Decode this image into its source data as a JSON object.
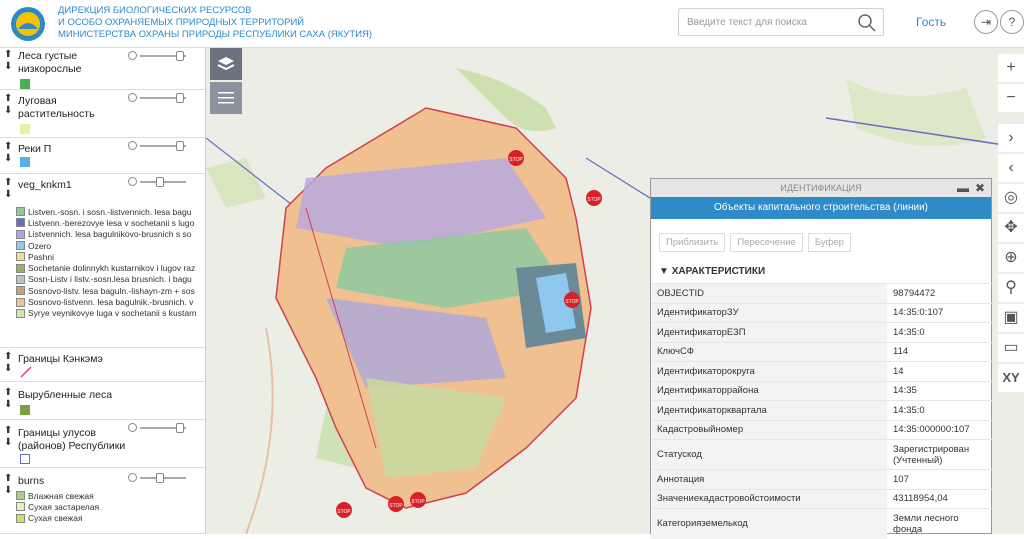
{
  "header": {
    "org_line1": "Дирекция биологических ресурсов",
    "org_line2": "и особо охраняемых природных территорий",
    "org_line3": "Министерства охраны природы Республики Саха (Якутия)",
    "search_placeholder": "Введите текст для поиска",
    "user": "Гость"
  },
  "layers": [
    {
      "name": "Леса густые низкорослые",
      "color": "#4caf50"
    },
    {
      "name": "Луговая растительность",
      "color": "#e4f2a0"
    },
    {
      "name": "Реки П",
      "color": "#5aaee8"
    },
    {
      "name": "veg_knkm1",
      "legend": [
        {
          "label": "Listven.-sosn. i sosn.-listvennich. lesa bagu",
          "color": "#8ec9a0"
        },
        {
          "label": "Listvenn.-berezovye lesa v sochetanii s lugo",
          "color": "#6a6ac8"
        },
        {
          "label": "Listvennich. lesa bagulnikovo-brusnich s so",
          "color": "#a8a8e0"
        },
        {
          "label": "Ozero",
          "color": "#8ec8f0"
        },
        {
          "label": "Pashni",
          "color": "#f5e08a"
        },
        {
          "label": "Sochetanie dolinnykh kustarnikov i lugov raz",
          "color": "#a0b060"
        },
        {
          "label": "Sosn-Listv i listv.-sosn.lesa brusnich. i bagu",
          "color": "#b8c8b8"
        },
        {
          "label": "Sosnovo-listv. lesa baguln.-lishayn-zm + sos",
          "color": "#c0a878"
        },
        {
          "label": "Sosnovo-listvenn. lesa bagulnik.-brusnich. v",
          "color": "#f0c090"
        },
        {
          "label": "Syrye veynikovye luga v sochetanii s kustarn",
          "color": "#d8e8a0"
        }
      ]
    },
    {
      "name": "Границы Кэнкэмэ",
      "color": "#e04060"
    },
    {
      "name": "Вырубленные леса",
      "color": "#7aa040"
    },
    {
      "name": "Границы улусов (районов) Республики",
      "color": "#ffffff"
    },
    {
      "name": "burns",
      "legend": [
        {
          "label": "Влажная свежая",
          "color": "#a8d080"
        },
        {
          "label": "Сухая застарелая",
          "color": "#e8f0c0"
        },
        {
          "label": "Сухая свежая",
          "color": "#c8e068"
        }
      ]
    }
  ],
  "panel": {
    "title": "Идентификация",
    "subtitle": "Объекты капитального строительства (линии)",
    "buttons": [
      "Приблизить",
      "Пересечение",
      "Буфер"
    ],
    "section": "ХАРАКТЕРИСТИКИ",
    "rows": [
      {
        "k": "OBJECTID",
        "v": "98794472"
      },
      {
        "k": "ИдентификаторЗУ",
        "v": "14:35:0:107"
      },
      {
        "k": "ИдентификаторЕЗП",
        "v": "14:35:0"
      },
      {
        "k": "КлючСФ",
        "v": "114"
      },
      {
        "k": "Идентификаторокруга",
        "v": "14"
      },
      {
        "k": "Идентификаторрайона",
        "v": "14:35"
      },
      {
        "k": "Идентификаторквартала",
        "v": "14:35:0"
      },
      {
        "k": "Кадастровыйномер",
        "v": "14:35:000000:107"
      },
      {
        "k": "Статускод",
        "v": "Зарегистрирован (Учтенный)"
      },
      {
        "k": "Аннотация",
        "v": "107"
      },
      {
        "k": "Значениекадастровойстоимости",
        "v": "43118954,04"
      },
      {
        "k": "Категорияземелькод",
        "v": "Земли лесного фонда"
      }
    ]
  },
  "map": {
    "stop_label": "STOP"
  },
  "tools": {
    "xy": "XY"
  }
}
